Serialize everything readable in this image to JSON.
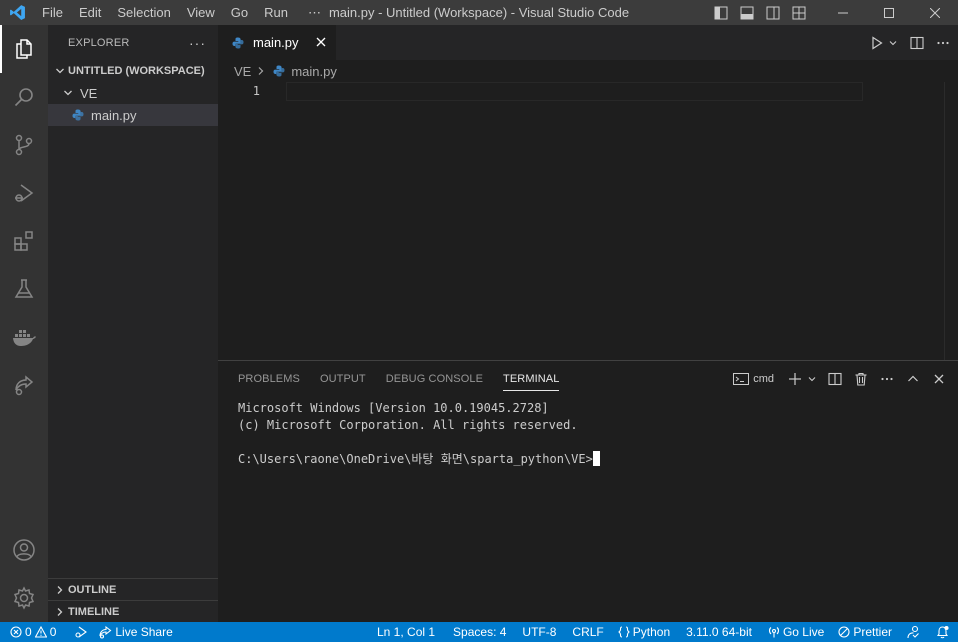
{
  "titlebar": {
    "menu": [
      "File",
      "Edit",
      "Selection",
      "View",
      "Go",
      "Run",
      "⋯"
    ],
    "title": "main.py - Untitled (Workspace) - Visual Studio Code"
  },
  "activitybar": {
    "items": [
      "explorer-icon",
      "search-icon",
      "source-control-icon",
      "run-debug-icon",
      "extensions-icon",
      "testing-icon",
      "docker-icon",
      "live-share-icon",
      "account-icon",
      "manage-gear-icon"
    ]
  },
  "sidebar": {
    "title": "EXPLORER",
    "more": "···",
    "workspace": "UNTITLED (WORKSPACE)",
    "folder": "VE",
    "file": "main.py",
    "outline": "OUTLINE",
    "timeline": "TIMELINE"
  },
  "editor": {
    "tab_label": "main.py",
    "breadcrumb_folder": "VE",
    "breadcrumb_file": "main.py",
    "line_number": "1"
  },
  "panel": {
    "tabs": [
      "PROBLEMS",
      "OUTPUT",
      "DEBUG CONSOLE",
      "TERMINAL"
    ],
    "active_tab": "TERMINAL",
    "terminal_name": "cmd",
    "terminal_lines": [
      "Microsoft Windows [Version 10.0.19045.2728]",
      "(c) Microsoft Corporation. All rights reserved.",
      "",
      "C:\\Users\\raone\\OneDrive\\바탕 화면\\sparta_python\\VE>"
    ]
  },
  "statusbar": {
    "errors": "0",
    "warnings": "0",
    "live_share": "Live Share",
    "position": "Ln 1, Col 1",
    "spaces": "Spaces: 4",
    "encoding": "UTF-8",
    "eol": "CRLF",
    "language": "Python",
    "interpreter": "3.11.0 64-bit",
    "go_live": "Go Live",
    "prettier": "Prettier"
  },
  "colors": {
    "accent": "#007acc",
    "titlebar": "#3c3c3c",
    "activitybar": "#333333",
    "sidebar": "#252526",
    "editor": "#1e1e1e",
    "python_blue": "#3f87c6",
    "python_yellow": "#ffd43b"
  }
}
